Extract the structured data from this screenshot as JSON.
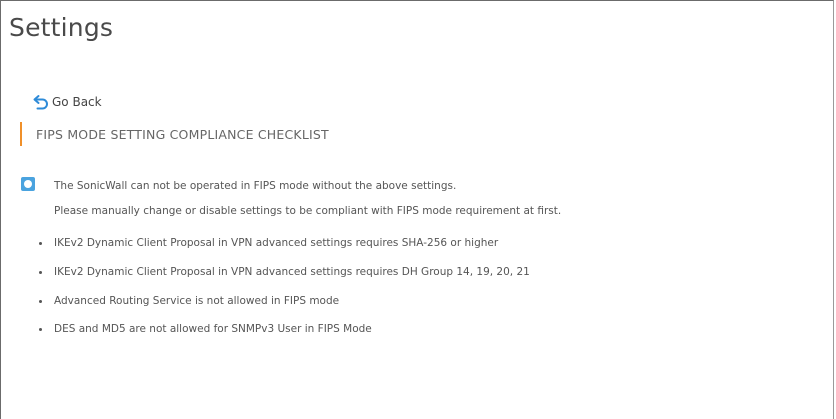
{
  "page": {
    "title": "Settings"
  },
  "nav": {
    "go_back_label": "Go Back",
    "go_back_icon": "undo-arrow-icon"
  },
  "section": {
    "header": "FIPS MODE SETTING COMPLIANCE CHECKLIST",
    "accent_color": "#f0902a"
  },
  "info": {
    "icon": "info-icon",
    "icon_color": "#4aa3df",
    "line1": "The SonicWall can not be operated in FIPS mode without the above settings.",
    "line2": "Please manually change or disable settings to be compliant with FIPS mode requirement at first."
  },
  "checklist": [
    "IKEv2 Dynamic Client Proposal in VPN advanced settings requires SHA-256 or higher",
    "IKEv2 Dynamic Client Proposal in VPN advanced settings requires DH Group 14, 19, 20, 21",
    "Advanced Routing Service is not allowed in FIPS mode",
    "DES and MD5 are not allowed for SNMPv3 User in FIPS Mode"
  ]
}
